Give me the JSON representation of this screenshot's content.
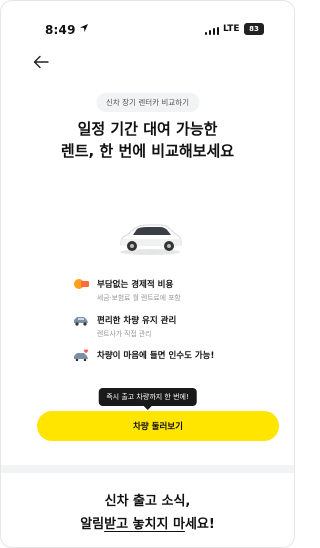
{
  "status_bar": {
    "time": "8:49",
    "network": "LTE",
    "battery": "83"
  },
  "header": {
    "back_icon": "arrow-left-icon"
  },
  "hero": {
    "pill": "신차 장기 렌터카 비교하기",
    "headline_line1": "일정 기간 대여 가능한",
    "headline_line2": "렌트, 한 번에 비교해보세요"
  },
  "features": [
    {
      "icon": "coin-icon",
      "title": "부담없는 경제적 비용",
      "subtitle": "세금·보험료 월 렌트료에 포함"
    },
    {
      "icon": "car-icon",
      "title": "편리한 차량 유지 관리",
      "subtitle": "렌트사가 직접 관리"
    },
    {
      "icon": "car-heart-icon",
      "title": "차량이 마음에 들면 인수도 가능!",
      "subtitle": ""
    }
  ],
  "tooltip": "즉시 출고 차량까지 한 번에!",
  "cta_label": "차량 둘러보기",
  "bottom": {
    "line1": "신차 출고 소식,",
    "line2_a": "알림",
    "line2_b": "받고 놓치지 마",
    "line2_c": "세요!"
  },
  "colors": {
    "accent": "#ffe500",
    "tooltip_bg": "#1a1a1a"
  }
}
